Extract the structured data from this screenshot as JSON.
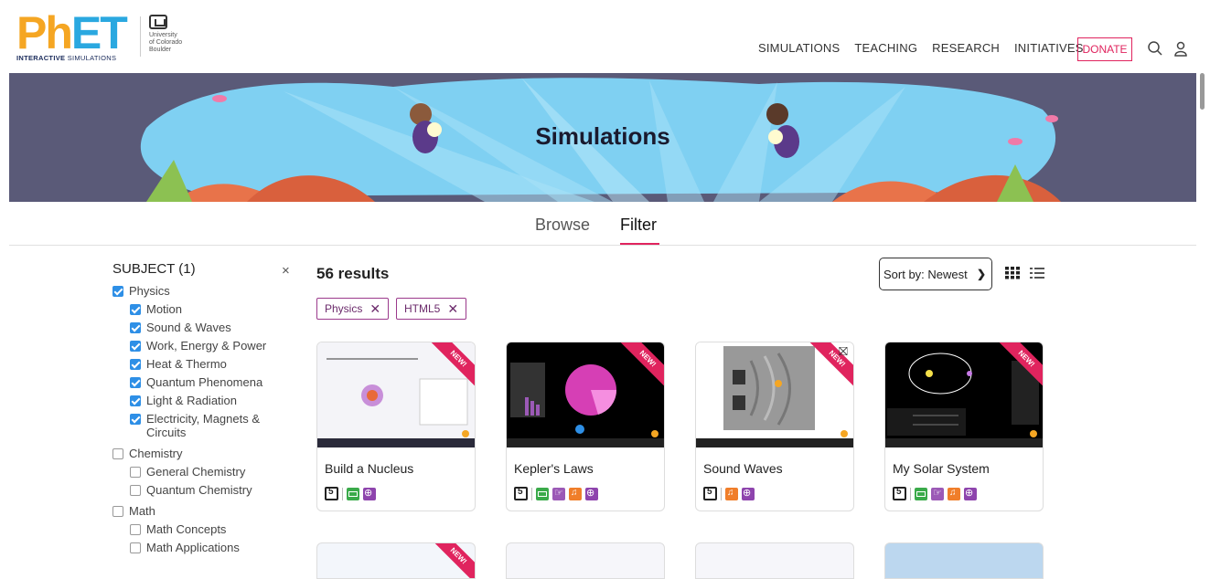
{
  "header": {
    "logo_main": "PhET",
    "logo_sub_bold": "INTERACTIVE",
    "logo_sub_rest": " SIMULATIONS",
    "university_lines": [
      "University",
      "of Colorado",
      "Boulder"
    ],
    "nav": [
      "SIMULATIONS",
      "TEACHING",
      "RESEARCH",
      "INITIATIVES"
    ],
    "donate": "DONATE",
    "icons": [
      "search-icon",
      "user-icon"
    ]
  },
  "banner": {
    "title": "Simulations"
  },
  "tabs": {
    "browse": "Browse",
    "filter": "Filter",
    "active": "Filter"
  },
  "sidebar": {
    "subject_label": "SUBJECT",
    "subject_count": "(1)",
    "groups": [
      {
        "label": "Physics",
        "checked": true,
        "children": [
          {
            "label": "Motion",
            "checked": true
          },
          {
            "label": "Sound & Waves",
            "checked": true
          },
          {
            "label": "Work, Energy & Power",
            "checked": true
          },
          {
            "label": "Heat & Thermo",
            "checked": true
          },
          {
            "label": "Quantum Phenomena",
            "checked": true
          },
          {
            "label": "Light & Radiation",
            "checked": true
          },
          {
            "label": "Electricity, Magnets & Circuits",
            "checked": true
          }
        ]
      },
      {
        "label": "Chemistry",
        "checked": false,
        "children": [
          {
            "label": "General Chemistry",
            "checked": false
          },
          {
            "label": "Quantum Chemistry",
            "checked": false
          }
        ]
      },
      {
        "label": "Math",
        "checked": false,
        "children": [
          {
            "label": "Math Concepts",
            "checked": false
          },
          {
            "label": "Math Applications",
            "checked": false
          }
        ]
      }
    ]
  },
  "results": {
    "count": "56 results",
    "chips": [
      "Physics",
      "HTML5"
    ],
    "sort_label": "Sort by: Newest",
    "cards": [
      {
        "title": "Build a Nucleus",
        "badges": [
          "html5",
          "keyboard",
          "zoom"
        ],
        "new": true,
        "new_label": "NEW!"
      },
      {
        "title": "Kepler's Laws",
        "badges": [
          "html5",
          "keyboard",
          "pointer",
          "sound",
          "zoom"
        ],
        "new": true,
        "new_label": "NEW!"
      },
      {
        "title": "Sound Waves",
        "badges": [
          "html5",
          "sound",
          "zoom"
        ],
        "new": true,
        "new_label": "NEW!"
      },
      {
        "title": "My Solar System",
        "badges": [
          "html5",
          "keyboard",
          "pointer",
          "sound",
          "zoom"
        ],
        "new": true,
        "new_label": "NEW!"
      }
    ]
  },
  "colors": {
    "accent": "#e0245e",
    "checkbox": "#2e8fe6",
    "chip_border": "#9b3a8c",
    "banner_bg": "#5a5a78",
    "water": "#6fc3ee"
  }
}
